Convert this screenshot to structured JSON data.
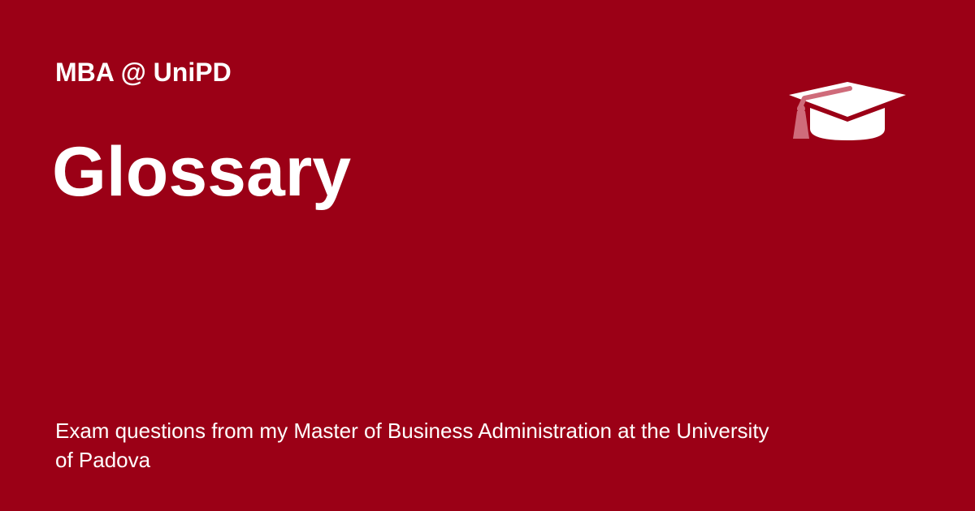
{
  "card": {
    "site_name": "MBA @ UniPD",
    "title": "Glossary",
    "description": "Exam questions from my Master of Business Administration at the University of Padova",
    "icon": "graduation-cap-icon"
  },
  "colors": {
    "background": "#9b0016",
    "text": "#ffffff",
    "icon_accent": "#cf6b7a"
  }
}
